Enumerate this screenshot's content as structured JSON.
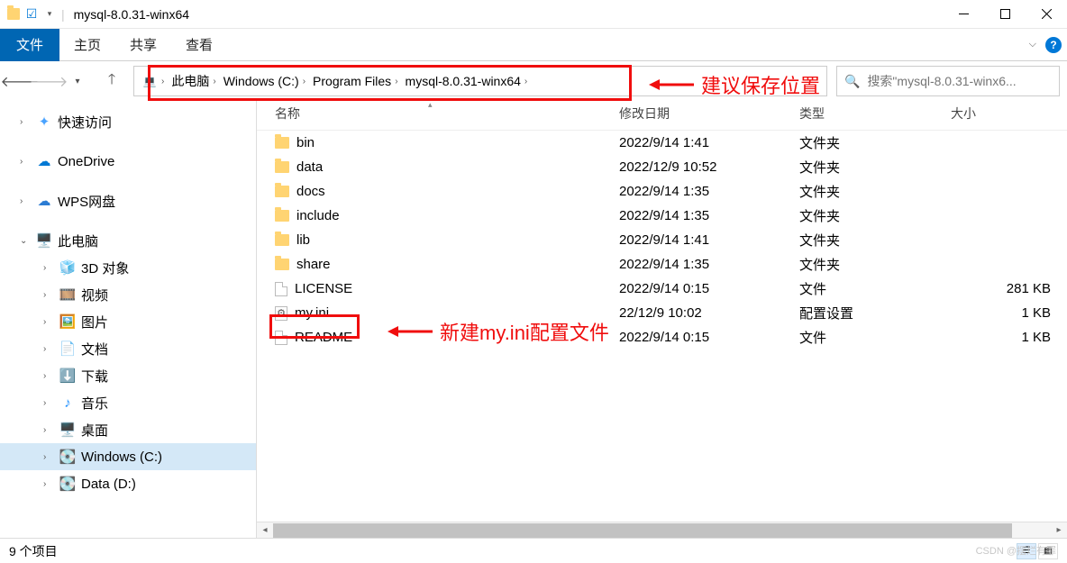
{
  "window": {
    "title": "mysql-8.0.31-winx64"
  },
  "ribbon": {
    "file": "文件",
    "home": "主页",
    "share": "共享",
    "view": "查看"
  },
  "breadcrumb": {
    "items": [
      "此电脑",
      "Windows (C:)",
      "Program Files",
      "mysql-8.0.31-winx64"
    ]
  },
  "search": {
    "placeholder": "搜索\"mysql-8.0.31-winx6..."
  },
  "sidebar": {
    "quick": "快速访问",
    "onedrive": "OneDrive",
    "wps": "WPS网盘",
    "thispc": "此电脑",
    "items": [
      "3D 对象",
      "视频",
      "图片",
      "文档",
      "下载",
      "音乐",
      "桌面",
      "Windows (C:)",
      "Data (D:)"
    ]
  },
  "columns": {
    "name": "名称",
    "date": "修改日期",
    "type": "类型",
    "size": "大小"
  },
  "files": [
    {
      "name": "bin",
      "date": "2022/9/14 1:41",
      "type": "文件夹",
      "size": "",
      "kind": "folder"
    },
    {
      "name": "data",
      "date": "2022/12/9 10:52",
      "type": "文件夹",
      "size": "",
      "kind": "folder"
    },
    {
      "name": "docs",
      "date": "2022/9/14 1:35",
      "type": "文件夹",
      "size": "",
      "kind": "folder"
    },
    {
      "name": "include",
      "date": "2022/9/14 1:35",
      "type": "文件夹",
      "size": "",
      "kind": "folder"
    },
    {
      "name": "lib",
      "date": "2022/9/14 1:41",
      "type": "文件夹",
      "size": "",
      "kind": "folder"
    },
    {
      "name": "share",
      "date": "2022/9/14 1:35",
      "type": "文件夹",
      "size": "",
      "kind": "folder"
    },
    {
      "name": "LICENSE",
      "date": "2022/9/14 0:15",
      "type": "文件",
      "size": "281 KB",
      "kind": "file"
    },
    {
      "name": "my.ini",
      "date": "22/12/9 10:02",
      "type": "配置设置",
      "size": "1 KB",
      "kind": "cog"
    },
    {
      "name": "README",
      "date": "2022/9/14 0:15",
      "type": "文件",
      "size": "1 KB",
      "kind": "file"
    }
  ],
  "status": {
    "text": "9 个项目"
  },
  "annotations": {
    "top": "建议保存位置",
    "mid": "新建my.ini配置文件"
  },
  "watermark": "CSDN @摆烂有罪"
}
